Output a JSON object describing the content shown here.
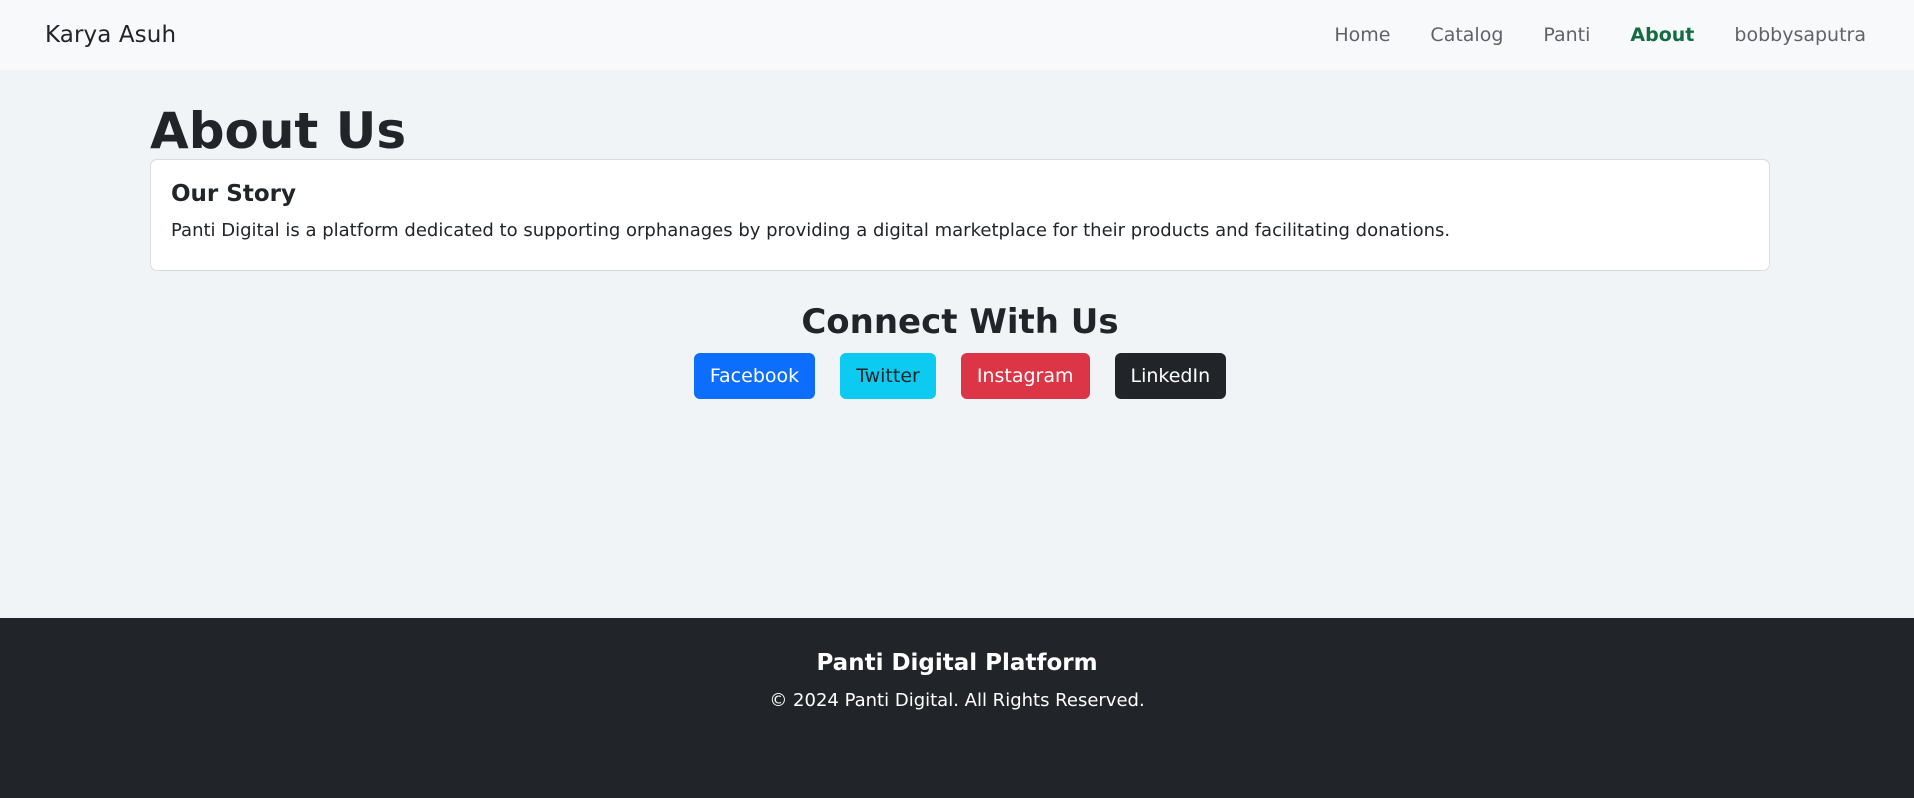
{
  "navbar": {
    "brand": "Karya Asuh",
    "links": [
      {
        "label": "Home"
      },
      {
        "label": "Catalog"
      },
      {
        "label": "Panti"
      },
      {
        "label": "About"
      },
      {
        "label": "bobbysaputra"
      }
    ]
  },
  "main": {
    "title": "About Us",
    "story": {
      "title": "Our Story",
      "text": "Panti Digital is a platform dedicated to supporting orphanages by providing a digital marketplace for their products and facilitating donations."
    },
    "connect": {
      "title": "Connect With Us",
      "buttons": [
        {
          "label": "Facebook",
          "color": "#0d6efd"
        },
        {
          "label": "Twitter",
          "color": "#0dcaf0"
        },
        {
          "label": "Instagram",
          "color": "#dc3545"
        },
        {
          "label": "LinkedIn",
          "color": "#212529"
        }
      ]
    }
  },
  "footer": {
    "title": "Panti Digital Platform",
    "copyright": "© 2024 Panti Digital. All Rights Reserved."
  },
  "colors": {
    "navbar_bg": "#f8f9fa",
    "page_bg": "#f1f4f7",
    "active_link": "#146c43",
    "footer_bg": "#212529"
  }
}
